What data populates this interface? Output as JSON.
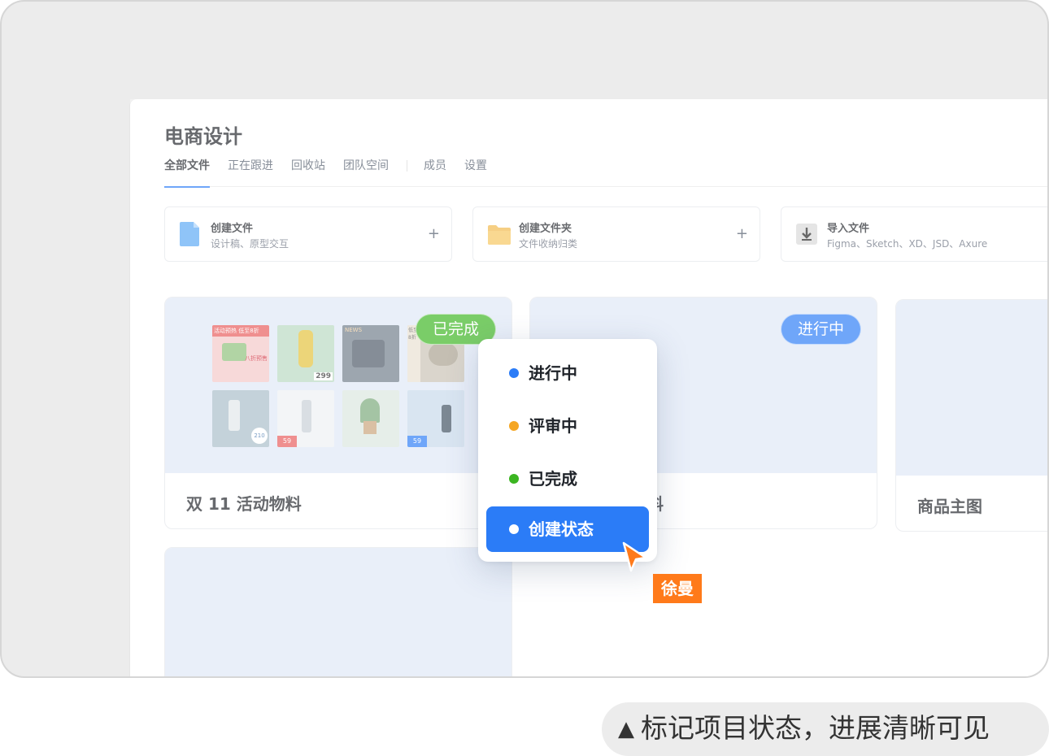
{
  "page": {
    "title": "电商设计"
  },
  "tabs": [
    {
      "label": "全部文件",
      "active": true
    },
    {
      "label": "正在跟进"
    },
    {
      "label": "回收站"
    },
    {
      "label": "团队空间"
    },
    {
      "label": "成员"
    },
    {
      "label": "设置"
    }
  ],
  "actions": [
    {
      "title": "创建文件",
      "subtitle": "设计稿、原型交互",
      "icon": "file-icon",
      "plus": "+"
    },
    {
      "title": "创建文件夹",
      "subtitle": "文件收纳归类",
      "icon": "folder-icon",
      "plus": "+"
    },
    {
      "title": "导入文件",
      "subtitle": "Figma、Sketch、XD、JSD、Axure",
      "icon": "import-icon",
      "plus": "+"
    }
  ],
  "projects": [
    {
      "name": "双 11 活动物料",
      "status": "已完成"
    },
    {
      "name": "料",
      "status": "进行中"
    },
    {
      "name": "商品主图"
    }
  ],
  "thumbnails": {
    "labels": [
      "活动预热 低至8折",
      "八折预售",
      "NEWS",
      "低至8折",
      "299",
      "210",
      "59",
      "59",
      "210"
    ]
  },
  "status_menu": {
    "items": [
      {
        "label": "进行中",
        "color": "#2b7cf7"
      },
      {
        "label": "评审中",
        "color": "#f5a623"
      },
      {
        "label": "已完成",
        "color": "#3bb521"
      },
      {
        "label": "创建状态",
        "color": "#ffffff",
        "selected": true
      }
    ]
  },
  "cursor": {
    "user": "徐曼"
  },
  "caption": {
    "marker": "▲",
    "text": "标记项目状态，进展清晰可见"
  },
  "colors": {
    "accent": "#2b7cf7",
    "done": "#3bb521",
    "review": "#f5a623",
    "user_tag": "#ff7a1a"
  }
}
